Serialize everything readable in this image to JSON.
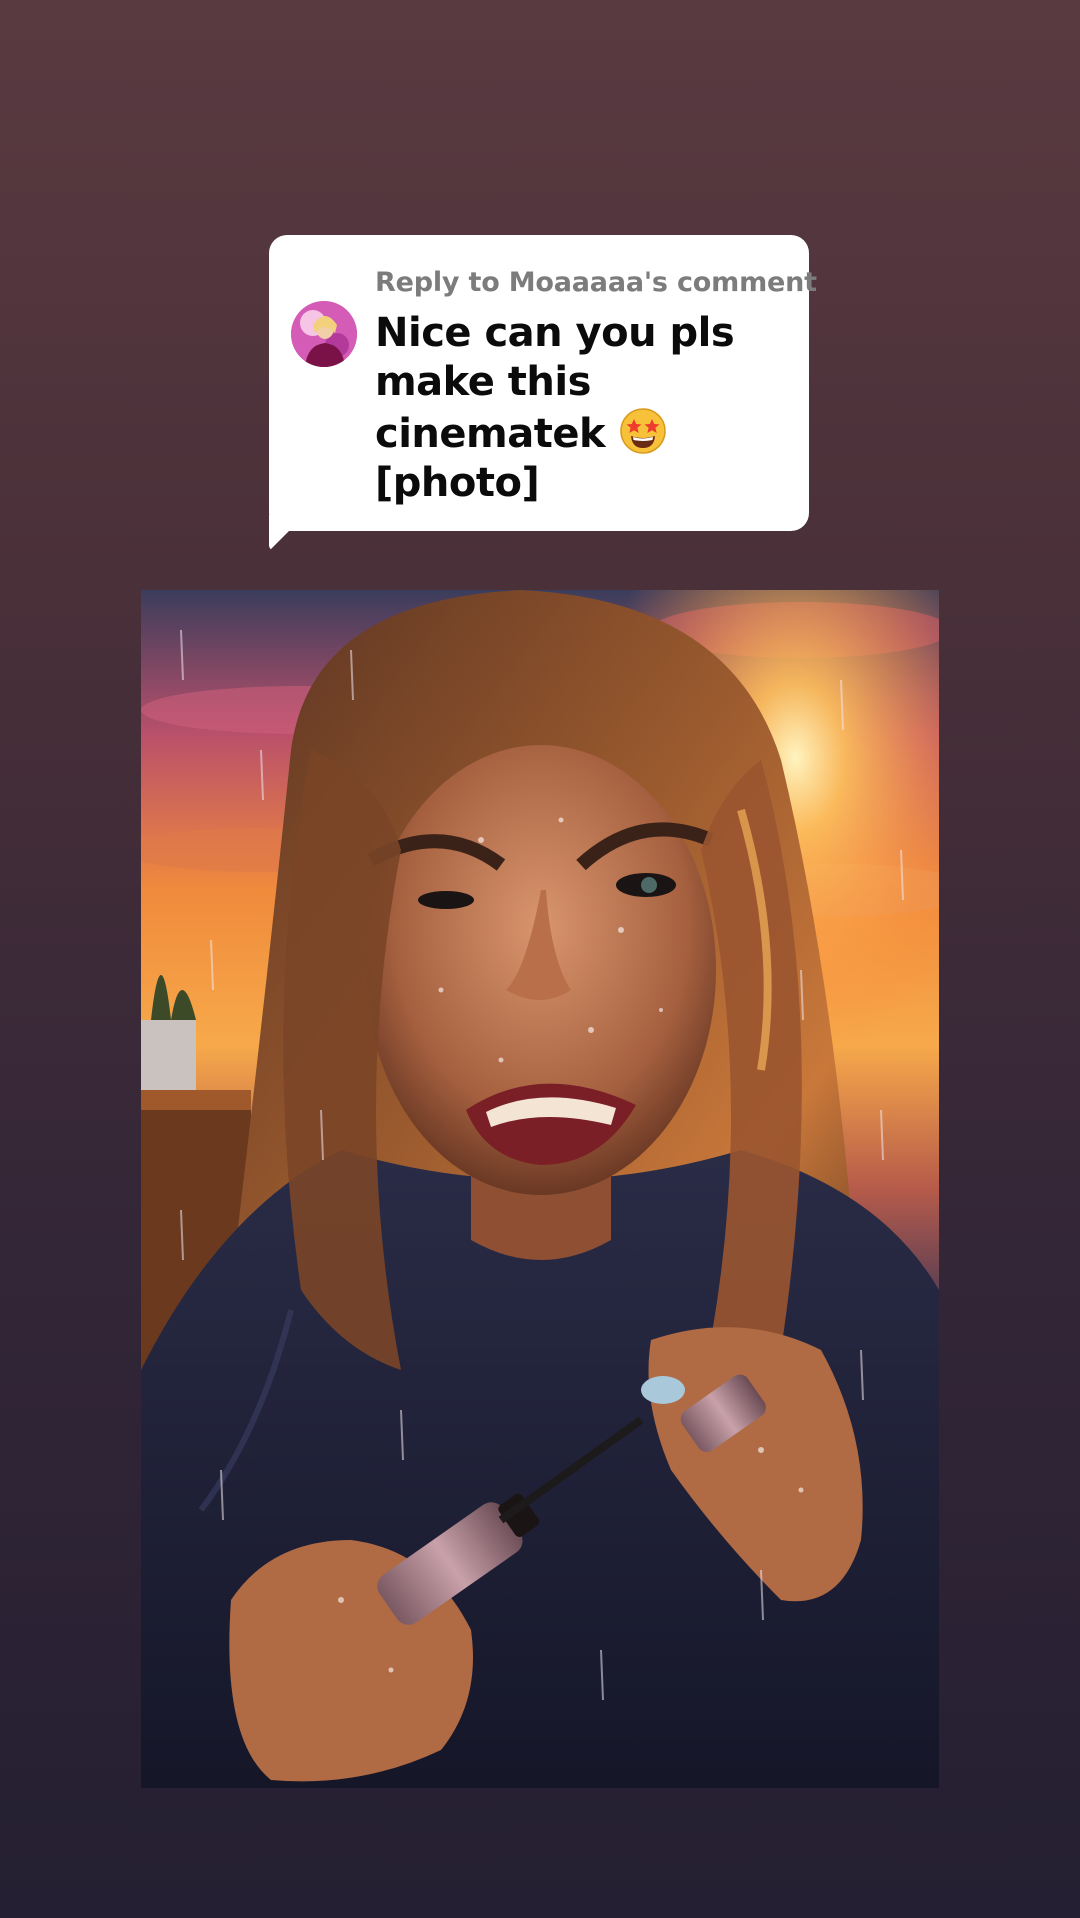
{
  "reply": {
    "header": "Reply to Moaaaaa's comment",
    "message": "Nice can you pls make this cinematek",
    "emoji_icon": "star-struck-emoji",
    "attachment": "[photo]"
  },
  "colors": {
    "background_top": "#5a3a41",
    "background_bottom": "#241f32",
    "card": "#ffffff",
    "header_text": "#7c7c7c",
    "body_text": "#0b0b0b"
  },
  "photo": {
    "icon": "portrait-photo"
  }
}
